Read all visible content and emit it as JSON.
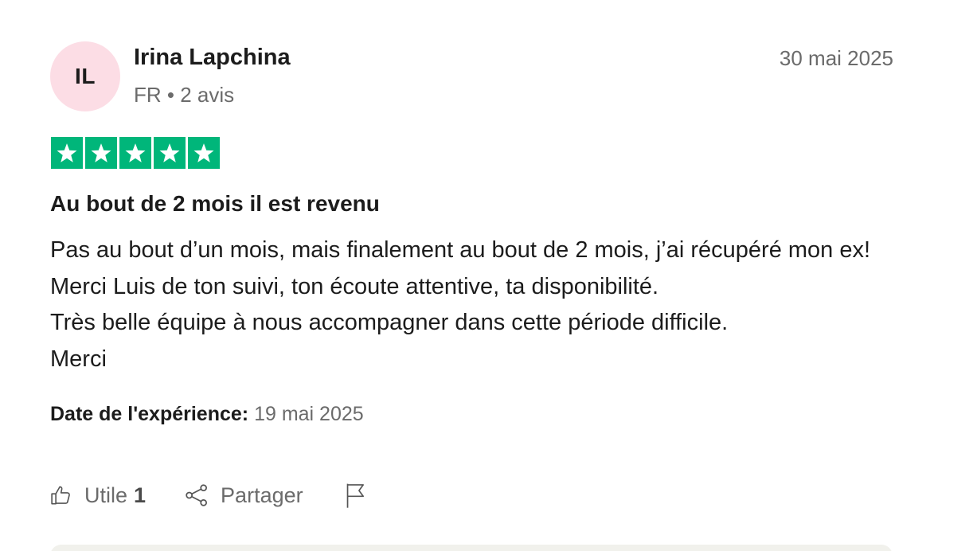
{
  "reviewer": {
    "initials": "IL",
    "name": "Irina Lapchina",
    "meta": "FR • 2 avis"
  },
  "review": {
    "date": "30 mai 2025",
    "rating": 5,
    "rating_color": "#00b67a",
    "title": "Au bout de 2 mois il est revenu",
    "body_lines": [
      "Pas au bout d’un mois, mais finalement au bout de 2 mois, j’ai récupéré mon ex! Merci Luis de ton suivi, ton écoute attentive, ta disponibilité.",
      "Très belle équipe à nous accompagner dans cette période difficile.",
      "Merci"
    ],
    "experience_label": "Date de l'expérience:",
    "experience_date": "19 mai 2025"
  },
  "actions": {
    "helpful_label": "Utile",
    "helpful_count": "1",
    "share_label": "Partager",
    "icons": [
      "thumbs-up-icon",
      "share-icon",
      "flag-icon"
    ]
  },
  "colors": {
    "avatar_bg": "#fcdde5",
    "muted_text": "#6b6b6b",
    "star_green": "#00b67a"
  }
}
